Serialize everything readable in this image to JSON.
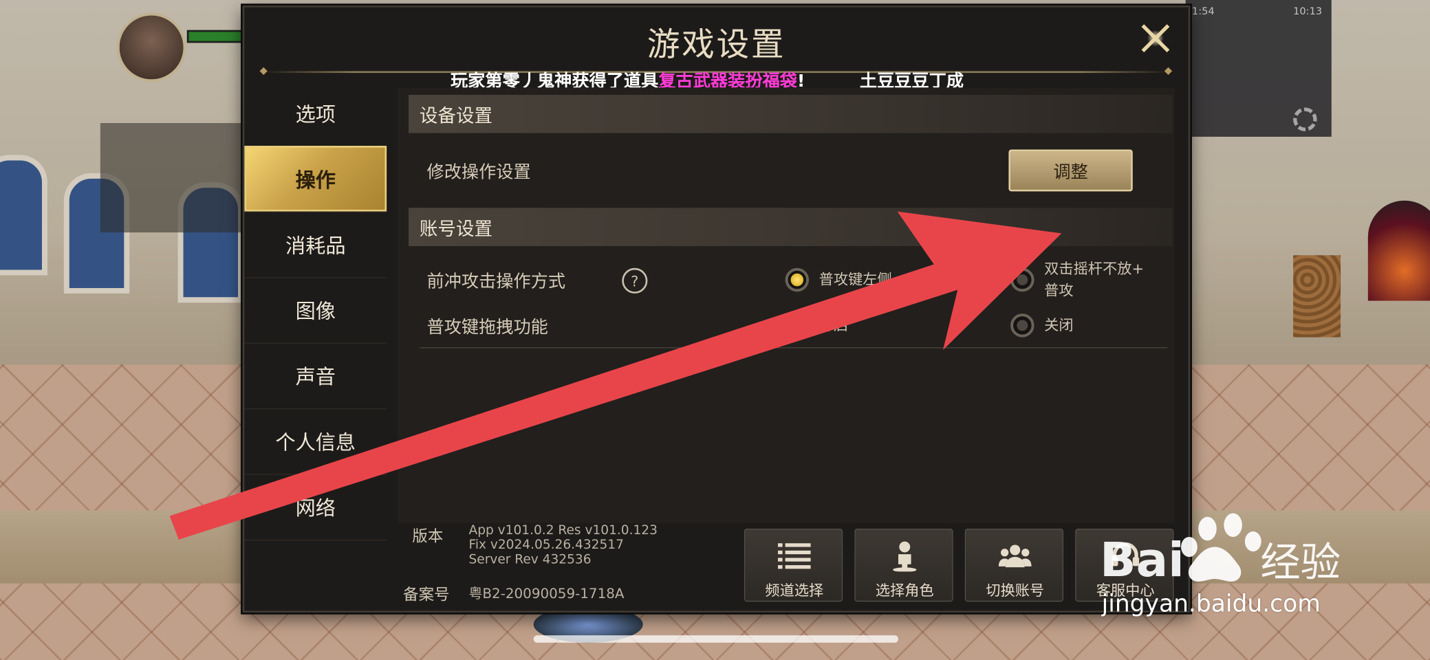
{
  "dialog": {
    "title": "游戏设置",
    "close_icon": "close-icon"
  },
  "ticker": {
    "part1": "玩家第零丿鬼神获得了道具",
    "item": "复古武器装扮福袋",
    "part2": "!",
    "part3": "土豆豆豆丁成",
    "highlight_color": "#ff3cd8"
  },
  "sidebar": {
    "items": [
      {
        "label": "选项"
      },
      {
        "label": "操作"
      },
      {
        "label": "消耗品"
      },
      {
        "label": "图像"
      },
      {
        "label": "声音"
      },
      {
        "label": "个人信息"
      },
      {
        "label": "网络"
      }
    ],
    "active_index": 1,
    "active_color": "#f6d774"
  },
  "device": {
    "header": "设备设置",
    "modify_label": "修改操作设置",
    "adjust_button": "调整"
  },
  "account": {
    "header": "账号设置",
    "dash_attack_label": "前冲攻击操作方式",
    "dash_option1": "普攻键左侧",
    "dash_option2_line1": "双击摇杆不放+",
    "dash_option2_line2": "普攻",
    "drag_label": "普攻键拖拽功能",
    "drag_option1": "开启",
    "drag_option2": "关闭"
  },
  "footer": {
    "version_label": "版本",
    "version_lines": [
      "App v101.0.2 Res v101.0.123",
      "Fix v2024.05.26.432517",
      "Server Rev 432536"
    ],
    "icp_label": "备案号",
    "icp_value": "粤B2-20090059-1718A",
    "buttons": [
      {
        "label": "频道选择",
        "icon": "list-icon"
      },
      {
        "label": "选择角色",
        "icon": "character-icon"
      },
      {
        "label": "切换账号",
        "icon": "group-icon"
      },
      {
        "label": "客服中心",
        "icon": "support-icon"
      }
    ]
  },
  "status_bar": {
    "time": "11:54",
    "clock": "10:13"
  },
  "watermark": {
    "brand": "Baidu经验",
    "url": "jingyan.baidu.com"
  },
  "annotation": {
    "arrow_color": "#e8454b"
  }
}
